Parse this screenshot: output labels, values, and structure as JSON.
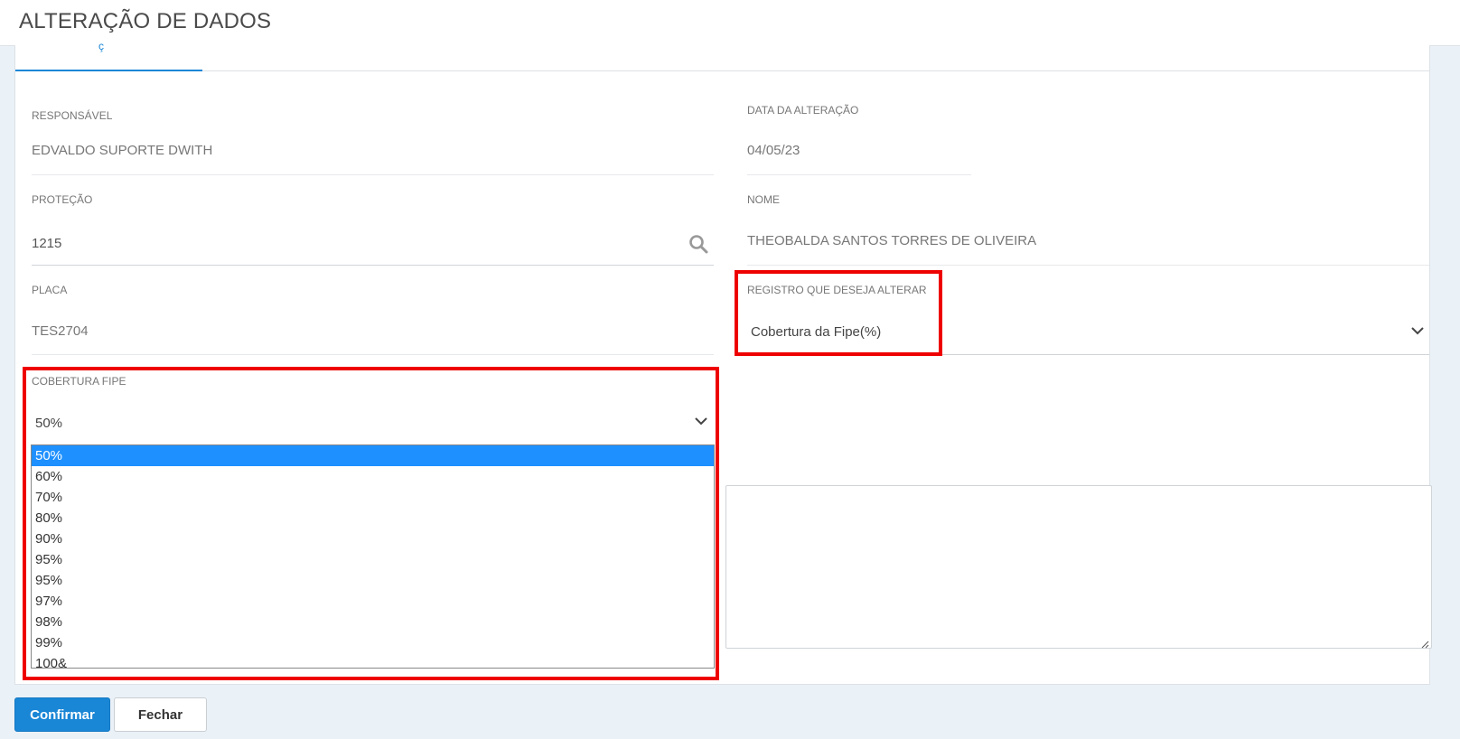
{
  "header": {
    "title": "ALTERAÇÃO DE DADOS"
  },
  "tabs": {
    "active_fragment": "ç"
  },
  "form": {
    "responsavel": {
      "label": "RESPONSÁVEL",
      "value": "EDVALDO SUPORTE DWITH"
    },
    "data_alteracao": {
      "label": "DATA DA ALTERAÇÃO",
      "value": "04/05/23"
    },
    "protecao": {
      "label": "PROTEÇÃO",
      "value": "1215",
      "icon": "search-icon"
    },
    "nome": {
      "label": "NOME",
      "value": "THEOBALDA SANTOS TORRES DE OLIVEIRA"
    },
    "placa": {
      "label": "PLACA",
      "value": "TES2704"
    },
    "registro": {
      "label": "REGISTRO QUE DESEJA ALTERAR",
      "value": "Cobertura da Fipe(%)",
      "icon": "chevron-down-icon"
    },
    "cobertura": {
      "label": "COBERTURA FIPE",
      "value": "50%",
      "icon": "chevron-down-icon",
      "options": [
        "50%",
        "60%",
        "70%",
        "80%",
        "90%",
        "95%",
        "95%",
        "97%",
        "98%",
        "99%",
        "100&"
      ],
      "selected_index": 0
    }
  },
  "buttons": {
    "confirm": "Confirmar",
    "close": "Fechar"
  },
  "colors": {
    "accent": "#1a86d6",
    "highlight": "#ee0000",
    "selected_option": "#1e90ff"
  }
}
